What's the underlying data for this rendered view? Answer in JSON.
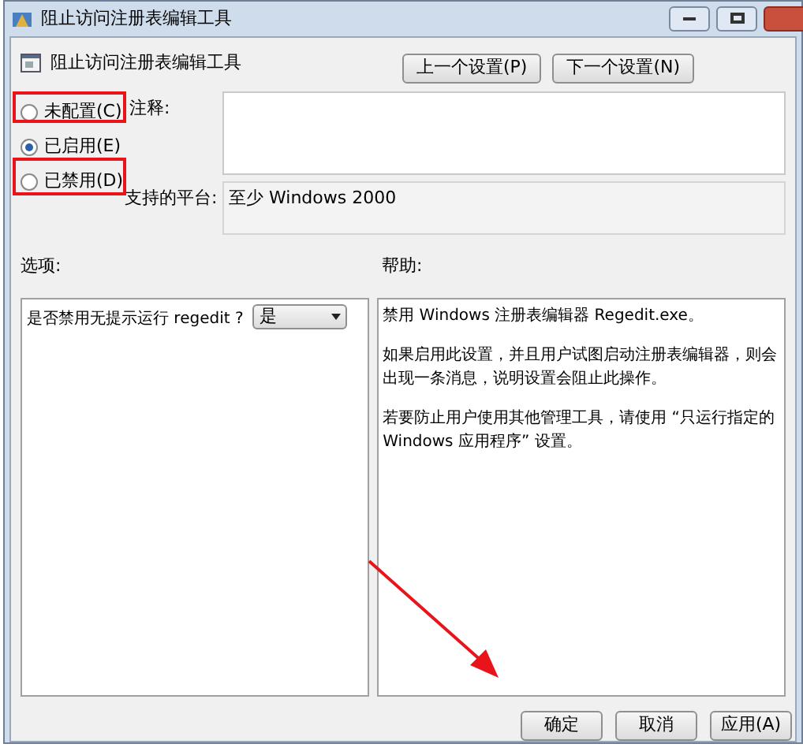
{
  "window": {
    "title": "阻止访问注册表编辑工具"
  },
  "header": {
    "title": "阻止访问注册表编辑工具",
    "buttons": [
      "上一个设置(P)",
      "下一个设置(N)"
    ]
  },
  "states": [
    {
      "label": "未配置(C)",
      "selected": false
    },
    {
      "label": "已启用(E)",
      "selected": true
    },
    {
      "label": "已禁用(D)",
      "selected": false
    }
  ],
  "comment": {
    "label": "注释:"
  },
  "platform": {
    "label": "支持的平台:",
    "value": "至少 Windows 2000"
  },
  "options": {
    "label": "选项:",
    "question": "是否禁用无提示运行 regedit ?",
    "value": "是"
  },
  "help": {
    "label": "帮助:",
    "paragraphs": [
      "禁用 Windows 注册表编辑器 Regedit.exe。",
      "如果启用此设置，并且用户试图启动注册表编辑器，则会出现一条消息，说明设置会阻止此操作。",
      "若要防止用户使用其他管理工具，请使用 “只运行指定的 Windows 应用程序” 设置。"
    ]
  },
  "footer": {
    "buttons": [
      "确定",
      "取消",
      "应用(A)"
    ]
  }
}
